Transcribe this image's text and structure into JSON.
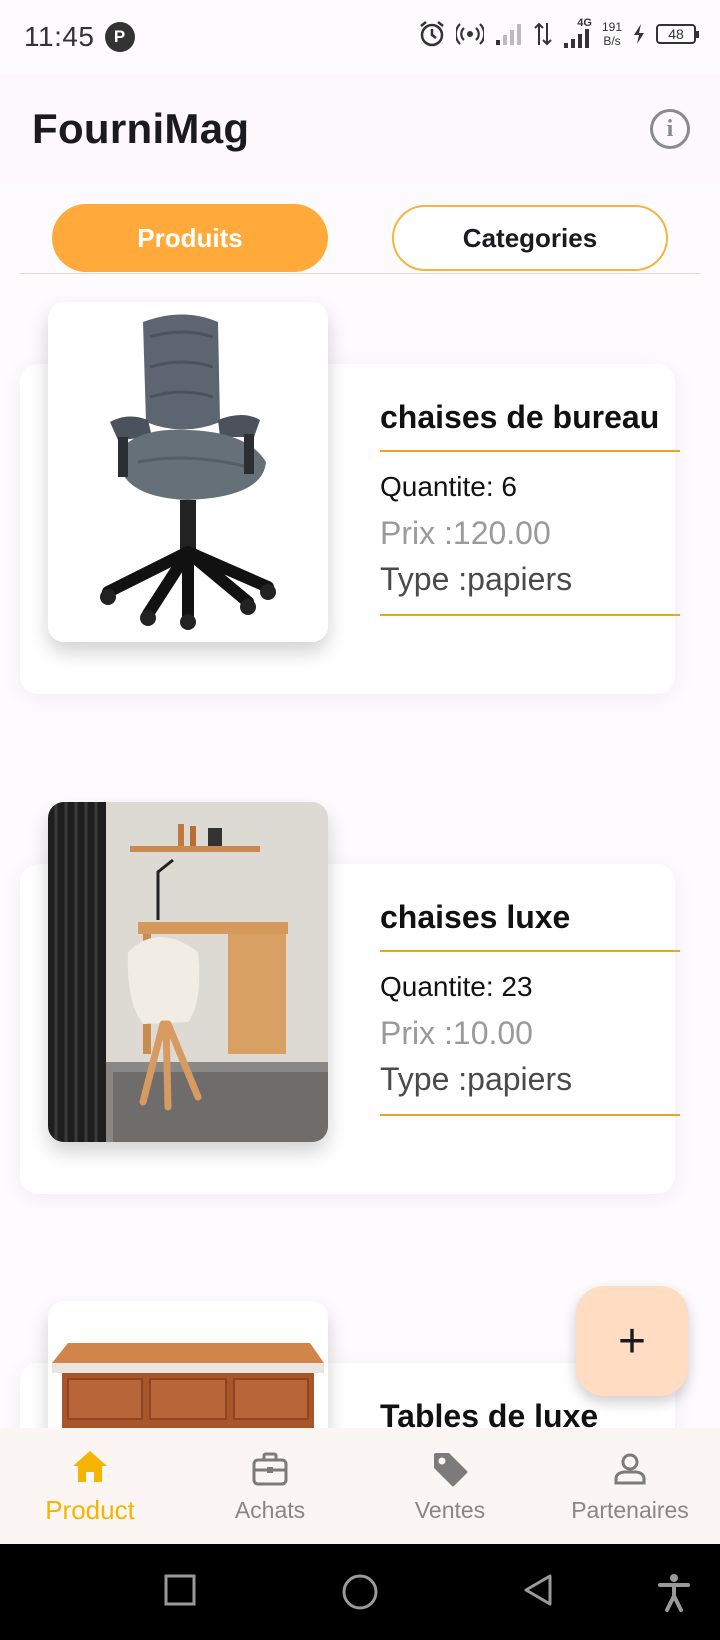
{
  "status_bar": {
    "time": "11:45",
    "p_badge": "P",
    "net_gen": "4G",
    "speed_value": "191",
    "speed_unit": "B/s",
    "battery": "48"
  },
  "app_bar": {
    "title": "FourniMag"
  },
  "tabs": [
    {
      "label": "Produits",
      "active": true
    },
    {
      "label": "Categories",
      "active": false
    }
  ],
  "products": [
    {
      "name": "chaises de bureau",
      "quantity": "Quantite: 6",
      "price": "Prix :120.00",
      "type": "Type :papiers",
      "image": "office-chair-icon"
    },
    {
      "name": "chaises luxe",
      "quantity": "Quantite: 23",
      "price": "Prix :10.00",
      "type": "Type :papiers",
      "image": "desk-room-icon"
    },
    {
      "name": "Tables de luxe",
      "image": "wooden-desk-icon"
    }
  ],
  "fab": {
    "label": "+"
  },
  "bottom_nav": [
    {
      "label": "Product",
      "icon": "home-icon",
      "active": true
    },
    {
      "label": "Achats",
      "icon": "briefcase-icon",
      "active": false
    },
    {
      "label": "Ventes",
      "icon": "tag-icon",
      "active": false
    },
    {
      "label": "Partenaires",
      "icon": "person-icon",
      "active": false
    }
  ],
  "colors": {
    "accent": "#ffaa3a",
    "divider": "#e8a622",
    "nav_active": "#f5b400",
    "fab": "#ffdcc2"
  }
}
